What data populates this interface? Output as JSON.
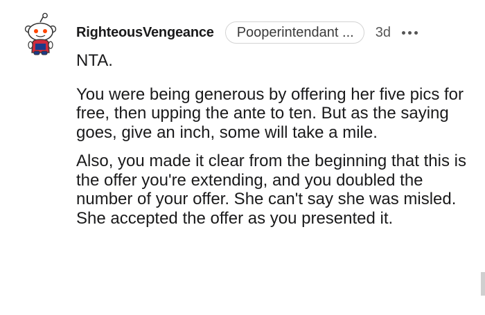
{
  "comment": {
    "username": "RighteousVengeance",
    "flair": "Pooperintendant ...",
    "timestamp": "3d",
    "more_icon": "more-horizontal-icon",
    "avatar_icon": "snoo-avatar-icon",
    "paragraphs": [
      "NTA.",
      "You were being generous by offering her five pics for free, then upping the ante to ten. But as the saying goes, give an inch, some will take a mile.",
      "Also, you made it clear from the beginning that this is the offer you're extending, and you doubled the number of your offer. She can't say she was misled. She accepted the offer as you presented it."
    ]
  },
  "colors": {
    "text": "#1a1a1b",
    "flair_border": "#d3d3d3",
    "meta": "#555555",
    "avatar_body": "#ce2b3e",
    "avatar_shirt": "#1b3a8a"
  }
}
